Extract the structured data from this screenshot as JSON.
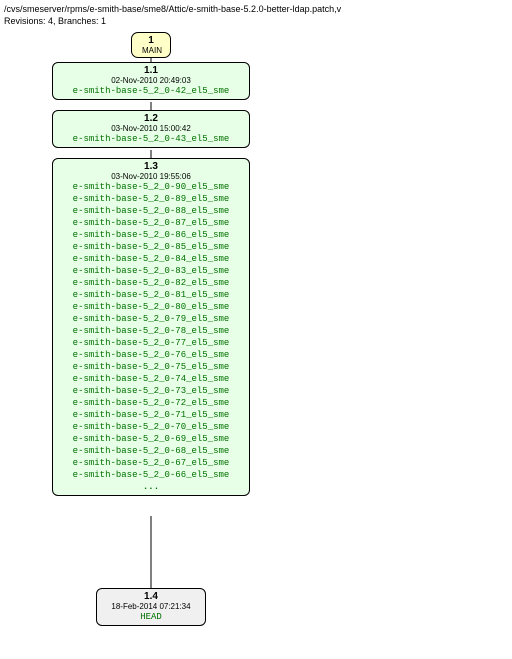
{
  "header": {
    "path": "/cvs/smeserver/rpms/e-smith-base/sme8/Attic/e-smith-base-5.2.0-better-ldap.patch,v",
    "meta": "Revisions: 4, Branches: 1"
  },
  "branch": {
    "num": "1",
    "name": "MAIN"
  },
  "nodes": {
    "n11": {
      "version": "1.1",
      "date": "02-Nov-2010 20:49:03",
      "tags": [
        "e-smith-base-5_2_0-42_el5_sme"
      ]
    },
    "n12": {
      "version": "1.2",
      "date": "03-Nov-2010 15:00:42",
      "tags": [
        "e-smith-base-5_2_0-43_el5_sme"
      ]
    },
    "n13": {
      "version": "1.3",
      "date": "03-Nov-2010 19:55:06",
      "tags": [
        "e-smith-base-5_2_0-90_el5_sme",
        "e-smith-base-5_2_0-89_el5_sme",
        "e-smith-base-5_2_0-88_el5_sme",
        "e-smith-base-5_2_0-87_el5_sme",
        "e-smith-base-5_2_0-86_el5_sme",
        "e-smith-base-5_2_0-85_el5_sme",
        "e-smith-base-5_2_0-84_el5_sme",
        "e-smith-base-5_2_0-83_el5_sme",
        "e-smith-base-5_2_0-82_el5_sme",
        "e-smith-base-5_2_0-81_el5_sme",
        "e-smith-base-5_2_0-80_el5_sme",
        "e-smith-base-5_2_0-79_el5_sme",
        "e-smith-base-5_2_0-78_el5_sme",
        "e-smith-base-5_2_0-77_el5_sme",
        "e-smith-base-5_2_0-76_el5_sme",
        "e-smith-base-5_2_0-75_el5_sme",
        "e-smith-base-5_2_0-74_el5_sme",
        "e-smith-base-5_2_0-73_el5_sme",
        "e-smith-base-5_2_0-72_el5_sme",
        "e-smith-base-5_2_0-71_el5_sme",
        "e-smith-base-5_2_0-70_el5_sme",
        "e-smith-base-5_2_0-69_el5_sme",
        "e-smith-base-5_2_0-68_el5_sme",
        "e-smith-base-5_2_0-67_el5_sme",
        "e-smith-base-5_2_0-66_el5_sme"
      ],
      "more": "..."
    },
    "n14": {
      "version": "1.4",
      "date": "18-Feb-2014 07:21:34",
      "tags": [
        "HEAD"
      ]
    }
  }
}
